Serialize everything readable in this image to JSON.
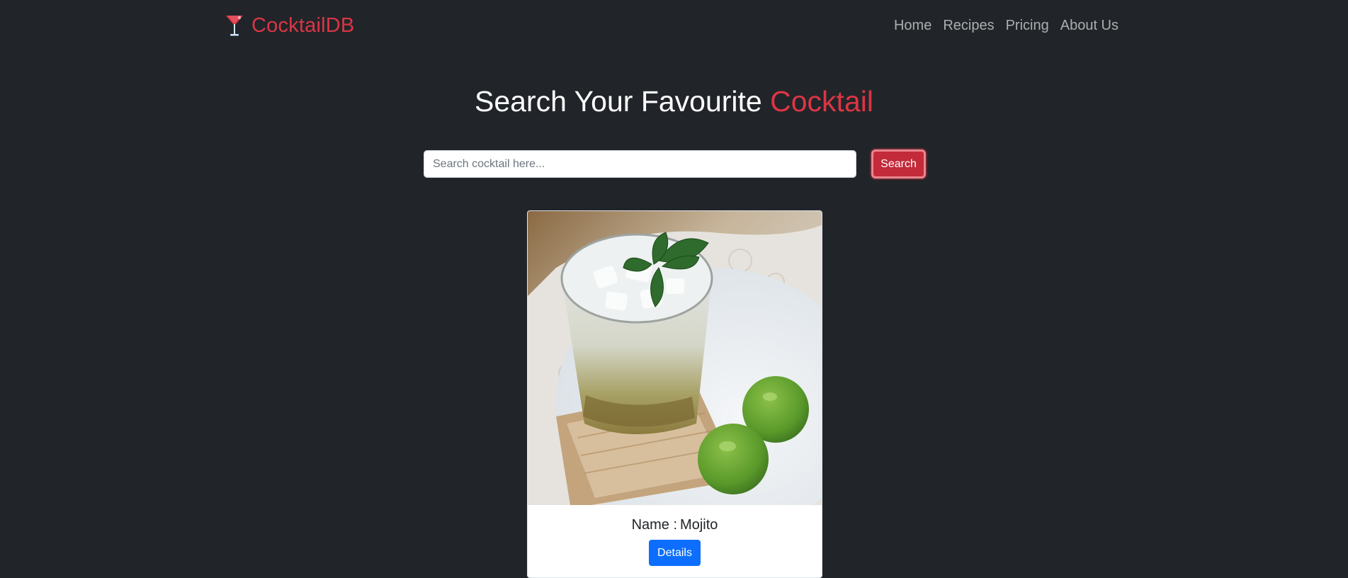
{
  "colors": {
    "background": "#212529",
    "accent": "#dc3545",
    "primary": "#0d6efd",
    "nav_link": "#9fa1a3"
  },
  "navbar": {
    "brand": {
      "icon": "cocktail-glass-icon",
      "label": "CocktailDB"
    },
    "links": [
      {
        "label": "Home"
      },
      {
        "label": "Recipes"
      },
      {
        "label": "Pricing"
      },
      {
        "label": "About Us"
      }
    ]
  },
  "hero": {
    "title_prefix": "Search Your Favourite",
    "title_accent": "Cocktail"
  },
  "search": {
    "placeholder": "Search cocktail here...",
    "value": "",
    "button_label": "Search"
  },
  "results": [
    {
      "image": "mojito-photo",
      "name_label": "Name :",
      "name": "Mojito",
      "details_label": "Details"
    }
  ]
}
